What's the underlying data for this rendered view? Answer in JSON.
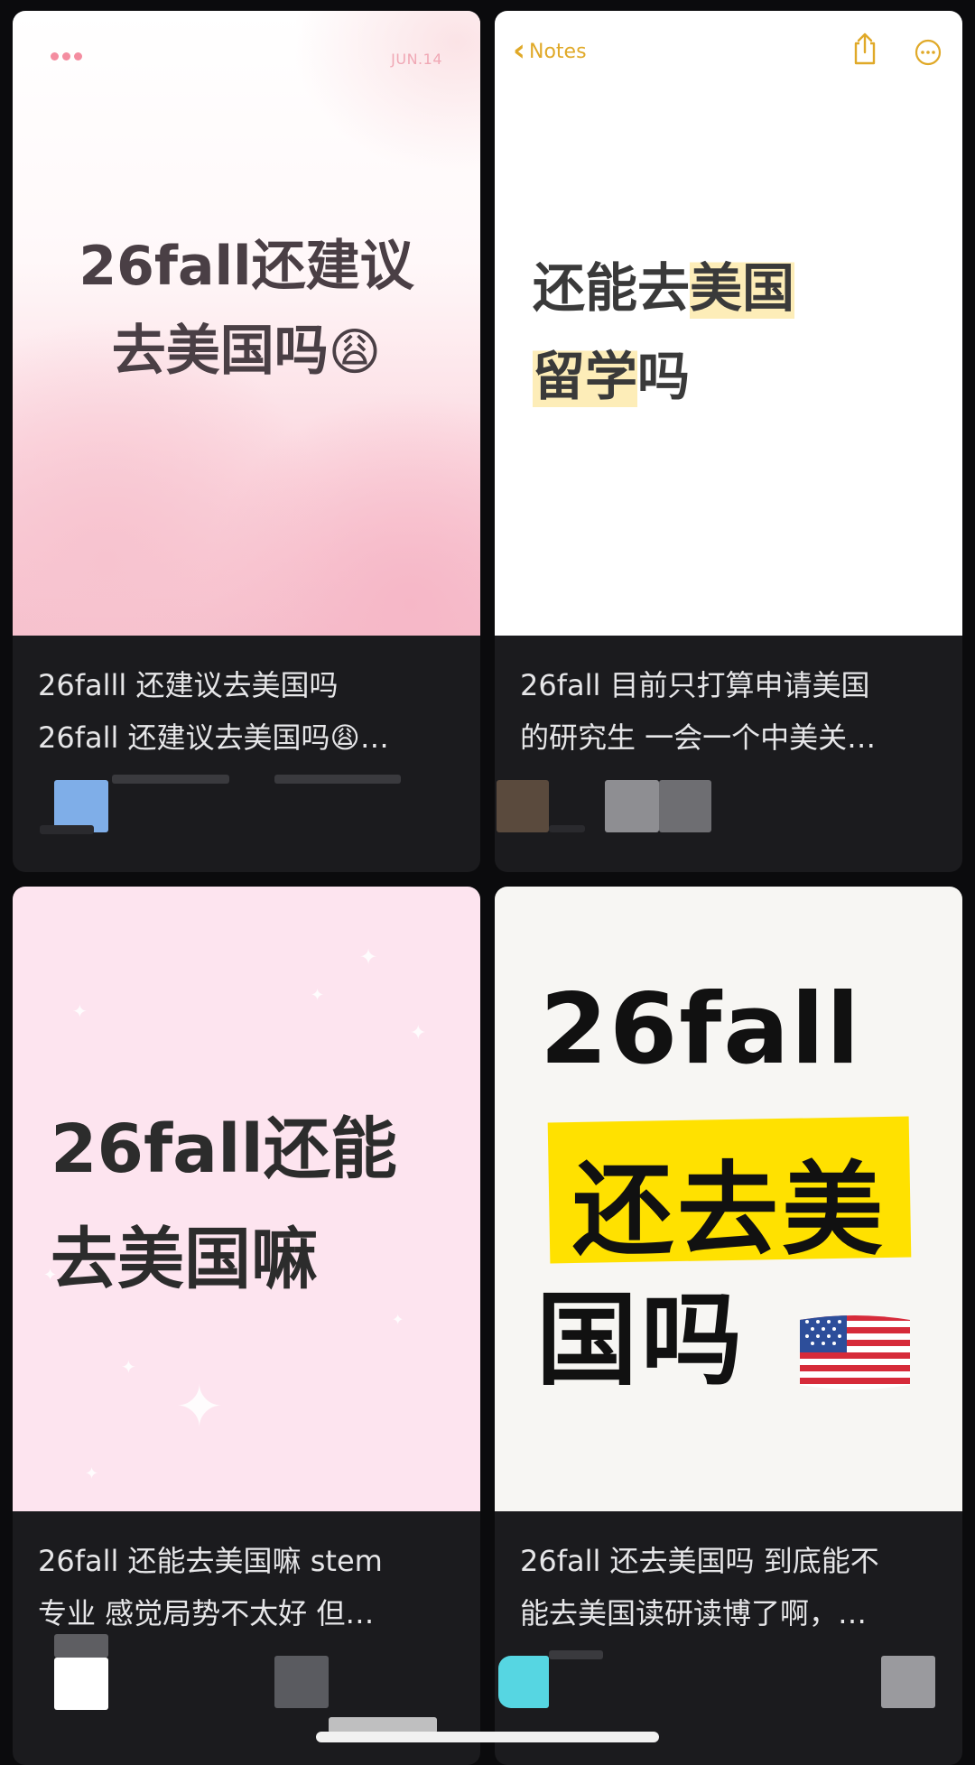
{
  "cards": [
    {
      "cover": {
        "date": "JUN.14",
        "title_line1": "26fall还建议",
        "title_line2": "去美国吗",
        "emoji": "😩"
      },
      "caption_line1": "26falll 还建议去美国吗",
      "caption_line2": "26fall 还建议去美国吗😩…"
    },
    {
      "cover": {
        "back_label": "Notes",
        "line1_plain": "还能去",
        "line1_highlight": "美国",
        "line2_highlight": "留学",
        "line2_plain": "吗"
      },
      "caption_line1": "26fall 目前只打算申请美国",
      "caption_line2": "的研究生 一会一个中美关…"
    },
    {
      "cover": {
        "title_line1": "26fall还能",
        "title_line2": "去美国嘛"
      },
      "caption_line1": "26fall 还能去美国嘛 stem",
      "caption_line2": "专业 感觉局势不太好 但…"
    },
    {
      "cover": {
        "line1": "26fall",
        "line2": "还去美",
        "line3": "国吗"
      },
      "caption_line1": "26fall 还去美国吗 到底能不",
      "caption_line2": "能去美国读研读博了啊，…"
    }
  ],
  "colors": {
    "page_bg": "#0b0b0d",
    "card_bg": "#1b1b1e",
    "notes_accent": "#e0a928",
    "highlight": "#fdedb8",
    "band_yellow": "#ffe100"
  },
  "icons": [
    "share-icon",
    "more-icon",
    "chevron-left-icon",
    "flag-us-icon",
    "sparkle-icon"
  ]
}
